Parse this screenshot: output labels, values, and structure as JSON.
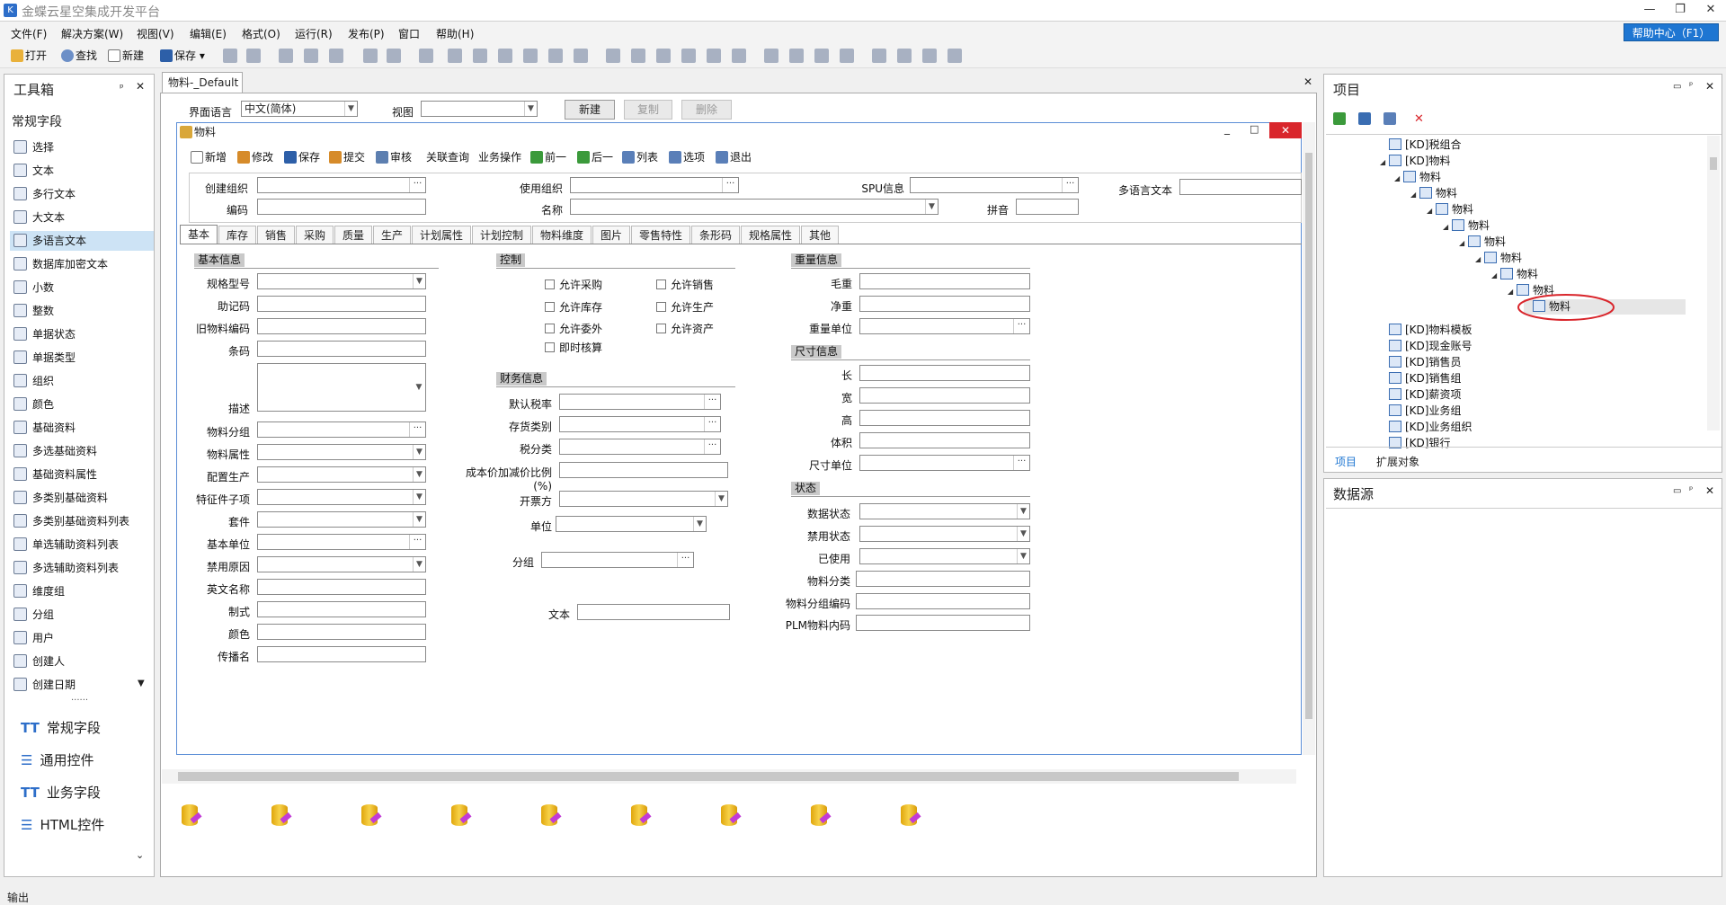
{
  "app": {
    "title": "金蝶云星空集成开发平台",
    "help_button": "帮助中心（F1）"
  },
  "menu": [
    "文件(F)",
    "解决方案(W)",
    "视图(V)",
    "编辑(E)",
    "格式(O)",
    "运行(R)",
    "发布(P)",
    "窗口",
    "帮助(H)"
  ],
  "toolbar": {
    "open": "打开",
    "find": "查找",
    "new": "新建",
    "save": "保存"
  },
  "toolbox": {
    "title": "工具箱",
    "section": "常规字段",
    "items": [
      "选择",
      "文本",
      "多行文本",
      "大文本",
      "多语言文本",
      "数据库加密文本",
      "小数",
      "整数",
      "单据状态",
      "单据类型",
      "组织",
      "颜色",
      "基础资料",
      "多选基础资料",
      "基础资料属性",
      "多类别基础资料",
      "多类别基础资料列表",
      "单选辅助资料列表",
      "多选辅助资料列表",
      "维度组",
      "分组",
      "用户",
      "创建人",
      "创建日期"
    ],
    "selected_index": 4,
    "categories": [
      "常规字段",
      "通用控件",
      "业务字段",
      "HTML控件"
    ]
  },
  "document": {
    "tab": "物料-_Default",
    "ui_language_label": "界面语言",
    "ui_language_value": "中文(简体)",
    "view_label": "视图",
    "new_btn": "新建",
    "copy_btn": "复制",
    "delete_btn": "删除",
    "form_title": "物料",
    "form_toolbar": [
      "新增",
      "修改",
      "保存",
      "提交",
      "审核",
      "关联查询",
      "业务操作",
      "前一",
      "后一",
      "列表",
      "选项",
      "退出"
    ],
    "head": {
      "create_org": "创建组织",
      "use_org": "使用组织",
      "spu": "SPU信息",
      "multi_lang": "多语言文本",
      "code": "编码",
      "name": "名称",
      "pinyin": "拼音"
    },
    "tabs": [
      "基本",
      "库存",
      "销售",
      "采购",
      "质量",
      "生产",
      "计划属性",
      "计划控制",
      "物料维度",
      "图片",
      "零售特性",
      "条形码",
      "规格属性",
      "其他"
    ],
    "basic_info": {
      "title": "基本信息",
      "fields": [
        "规格型号",
        "助记码",
        "旧物料编码",
        "条码",
        "描述",
        "物料分组",
        "物料属性",
        "配置生产",
        "特征件子项",
        "套件",
        "基本单位",
        "禁用原因",
        "英文名称",
        "制式",
        "颜色",
        "传播名"
      ]
    },
    "control": {
      "title": "控制",
      "checks": [
        "允许采购",
        "允许销售",
        "允许库存",
        "允许生产",
        "允许委外",
        "允许资产",
        "即时核算"
      ]
    },
    "finance": {
      "title": "财务信息",
      "fields": [
        "默认税率",
        "存货类别",
        "税分类",
        "成本价加减价比例(%)",
        "开票方",
        "单位",
        "分组",
        "文本"
      ]
    },
    "weight": {
      "title": "重量信息",
      "fields": [
        "毛重",
        "净重",
        "重量单位"
      ]
    },
    "size": {
      "title": "尺寸信息",
      "fields": [
        "长",
        "宽",
        "高",
        "体积",
        "尺寸单位"
      ]
    },
    "status": {
      "title": "状态",
      "fields": [
        "数据状态",
        "禁用状态",
        "已使用",
        "物料分类",
        "物料分组编码",
        "PLM物料内码"
      ]
    }
  },
  "project": {
    "title": "项目",
    "tree": [
      "[KD]税组合",
      "[KD]物料",
      "物料",
      "物料",
      "物料",
      "物料",
      "物料",
      "物料",
      "物料",
      "物料",
      "物料",
      "[KD]物料模板",
      "[KD]现金账号",
      "[KD]销售员",
      "[KD]销售组",
      "[KD]薪资项",
      "[KD]业务组",
      "[KD]业务组织",
      "[KD]银行"
    ],
    "tabs": [
      "项目",
      "扩展对象"
    ]
  },
  "datasource": {
    "title": "数据源"
  },
  "output": {
    "label": "输出"
  },
  "colors": {
    "accent": "#1e76d2",
    "selected": "#cde3f5",
    "highlight_circle": "#d9262c"
  }
}
